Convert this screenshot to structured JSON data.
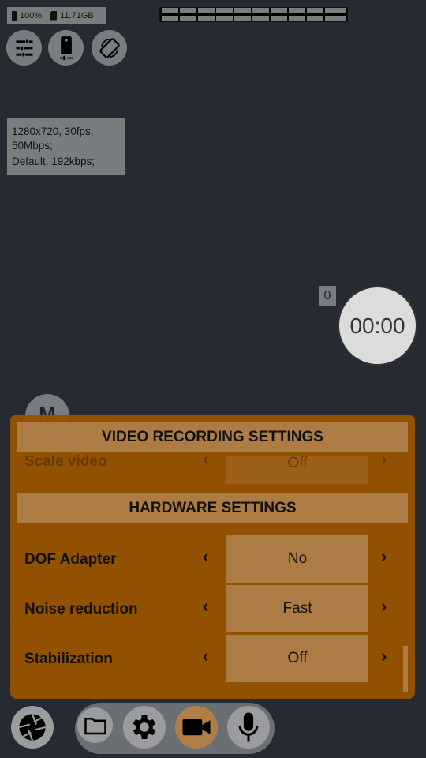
{
  "status": {
    "battery": "100%",
    "storage": "11.71GB"
  },
  "info": {
    "video": "1280x720, 30fps, 50Mbps;",
    "audio": "Default, 192kbps;"
  },
  "counter": "0",
  "timer": "00:00",
  "manual_label": "M",
  "settings": {
    "video_header": "VIDEO RECORDING SETTINGS",
    "scale_video": {
      "label": "Scale video",
      "value": "Off"
    },
    "hardware_header": "HARDWARE SETTINGS",
    "rows": [
      {
        "label": "DOF Adapter",
        "value": "No"
      },
      {
        "label": "Noise reduction",
        "value": "Fast"
      },
      {
        "label": "Stabilization",
        "value": "Off"
      }
    ],
    "prev": "‹",
    "next": "›"
  },
  "colors": {
    "background": "#252a33",
    "panel": "#955200",
    "accent": "#b07f45"
  }
}
